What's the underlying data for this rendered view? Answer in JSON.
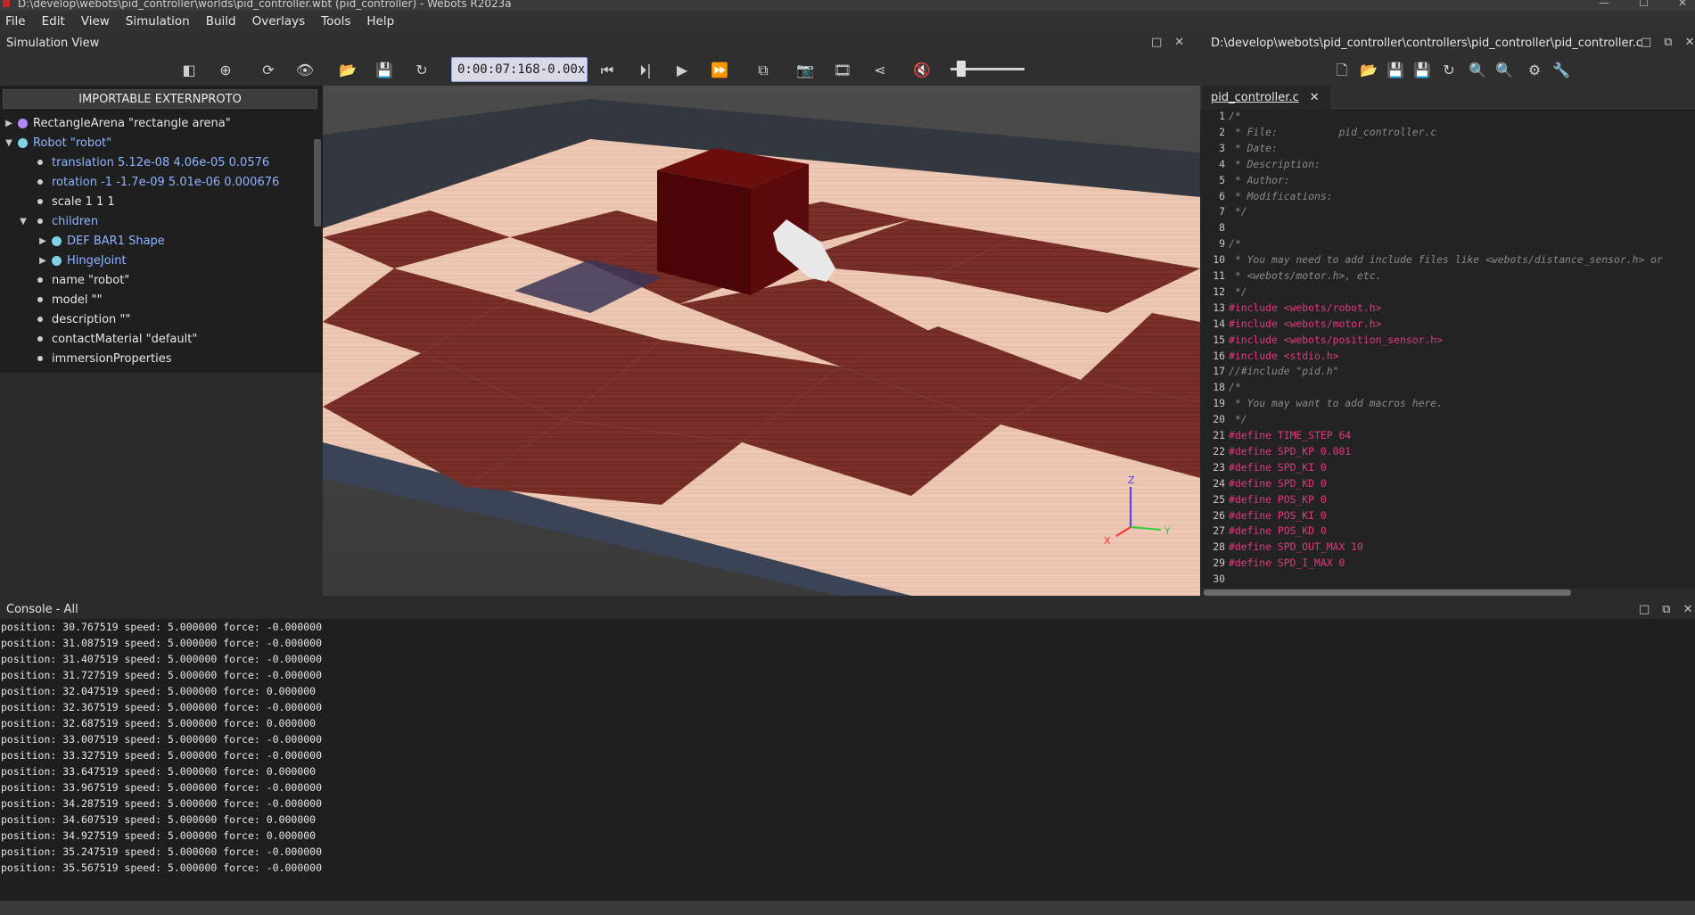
{
  "window": {
    "title": "D:\\develop\\webots\\pid_controller\\worlds\\pid_controller.wbt (pid_controller) - Webots R2023a"
  },
  "menu": [
    "File",
    "Edit",
    "View",
    "Simulation",
    "Build",
    "Overlays",
    "Tools",
    "Help"
  ],
  "simulation_view": {
    "title": "Simulation View",
    "time": "0:00:07:168",
    "separator": "-",
    "speed": "0.00x",
    "volume": 0.15
  },
  "scene_tree": {
    "externproto_button": "IMPORTABLE EXTERNPROTO",
    "nodes": [
      {
        "label": "RectangleArena \"rectangle arena\"",
        "dot": "#b388ff"
      },
      {
        "label": "Robot \"robot\"",
        "dot": "#7fd3e6"
      }
    ],
    "fields": [
      {
        "label": "translation 5.12e-08 4.06e-05 0.0576",
        "blue": true
      },
      {
        "label": "rotation -1 -1.7e-09 5.01e-06 0.000676",
        "blue": true
      },
      {
        "label": "scale 1 1 1",
        "blue": false
      },
      {
        "label": "children",
        "blue": true
      }
    ],
    "children": [
      {
        "label": "DEF BAR1 Shape",
        "dot": "#7fd3e6"
      },
      {
        "label": "HingeJoint",
        "dot": "#7fd3e6"
      }
    ],
    "more_fields": [
      "name \"robot\"",
      "model \"\"",
      "description \"\"",
      "contactMaterial \"default\"",
      "immersionProperties"
    ]
  },
  "viewport": {
    "axes": {
      "z": "Z",
      "y": "Y",
      "x": "X"
    }
  },
  "editor": {
    "path": "D:\\develop\\webots\\pid_controller\\controllers\\pid_controller\\pid_controller.c",
    "tab": "pid_controller.c",
    "lines": [
      {
        "n": "1",
        "text": "/*",
        "kind": "cm"
      },
      {
        "n": "2",
        "text": " * File:          pid_controller.c",
        "kind": "cm"
      },
      {
        "n": "3",
        "text": " * Date:",
        "kind": "cm"
      },
      {
        "n": "4",
        "text": " * Description:",
        "kind": "cm"
      },
      {
        "n": "5",
        "text": " * Author:",
        "kind": "cm"
      },
      {
        "n": "6",
        "text": " * Modifications:",
        "kind": "cm"
      },
      {
        "n": "7",
        "text": " */",
        "kind": "cm"
      },
      {
        "n": "8",
        "text": "",
        "kind": "cm"
      },
      {
        "n": "9",
        "text": "/*",
        "kind": "cm"
      },
      {
        "n": "10",
        "text": " * You may need to add include files like <webots/distance_sensor.h> or",
        "kind": "cm"
      },
      {
        "n": "11",
        "text": " * <webots/motor.h>, etc.",
        "kind": "cm"
      },
      {
        "n": "12",
        "text": " */",
        "kind": "cm"
      },
      {
        "n": "13",
        "text": "#include <webots/robot.h>",
        "kind": "pp"
      },
      {
        "n": "14",
        "text": "#include <webots/motor.h>",
        "kind": "pp"
      },
      {
        "n": "15",
        "text": "#include <webots/position_sensor.h>",
        "kind": "pp"
      },
      {
        "n": "16",
        "text": "#include <stdio.h>",
        "kind": "pp"
      },
      {
        "n": "17",
        "text": "//#include \"pid.h\"",
        "kind": "cm"
      },
      {
        "n": "18",
        "text": "/*",
        "kind": "cm"
      },
      {
        "n": "19",
        "text": " * You may want to add macros here.",
        "kind": "cm"
      },
      {
        "n": "20",
        "text": " */",
        "kind": "cm"
      },
      {
        "n": "21",
        "text": "#define TIME_STEP 64",
        "kind": "pp"
      },
      {
        "n": "22",
        "text": "#define SPD_KP 0.001",
        "kind": "pp"
      },
      {
        "n": "23",
        "text": "#define SPD_KI 0",
        "kind": "pp"
      },
      {
        "n": "24",
        "text": "#define SPD_KD 0",
        "kind": "pp"
      },
      {
        "n": "25",
        "text": "#define POS_KP 0",
        "kind": "pp"
      },
      {
        "n": "26",
        "text": "#define POS_KI 0",
        "kind": "pp"
      },
      {
        "n": "27",
        "text": "#define POS_KD 0",
        "kind": "pp"
      },
      {
        "n": "28",
        "text": "#define SPD_OUT_MAX 10",
        "kind": "pp"
      },
      {
        "n": "29",
        "text": "#define SPD_I_MAX 0",
        "kind": "pp"
      },
      {
        "n": "30",
        "text": "",
        "kind": "cm"
      }
    ]
  },
  "console": {
    "title": "Console - All",
    "lines": [
      "position: 30.767519 speed: 5.000000 force: -0.000000",
      "position: 31.087519 speed: 5.000000 force: -0.000000",
      "position: 31.407519 speed: 5.000000 force: -0.000000",
      "position: 31.727519 speed: 5.000000 force: -0.000000",
      "position: 32.047519 speed: 5.000000 force: 0.000000",
      "position: 32.367519 speed: 5.000000 force: -0.000000",
      "position: 32.687519 speed: 5.000000 force: 0.000000",
      "position: 33.007519 speed: 5.000000 force: -0.000000",
      "position: 33.327519 speed: 5.000000 force: -0.000000",
      "position: 33.647519 speed: 5.000000 force: 0.000000",
      "position: 33.967519 speed: 5.000000 force: -0.000000",
      "position: 34.287519 speed: 5.000000 force: -0.000000",
      "position: 34.607519 speed: 5.000000 force: 0.000000",
      "position: 34.927519 speed: 5.000000 force: 0.000000",
      "position: 35.247519 speed: 5.000000 force: -0.000000",
      "position: 35.567519 speed: 5.000000 force: -0.000000"
    ]
  },
  "colors": {
    "accent": "#8fb4ff",
    "preprocessor": "#e0397f",
    "comment": "#8a8a8a",
    "box": "#5a0a0a"
  }
}
